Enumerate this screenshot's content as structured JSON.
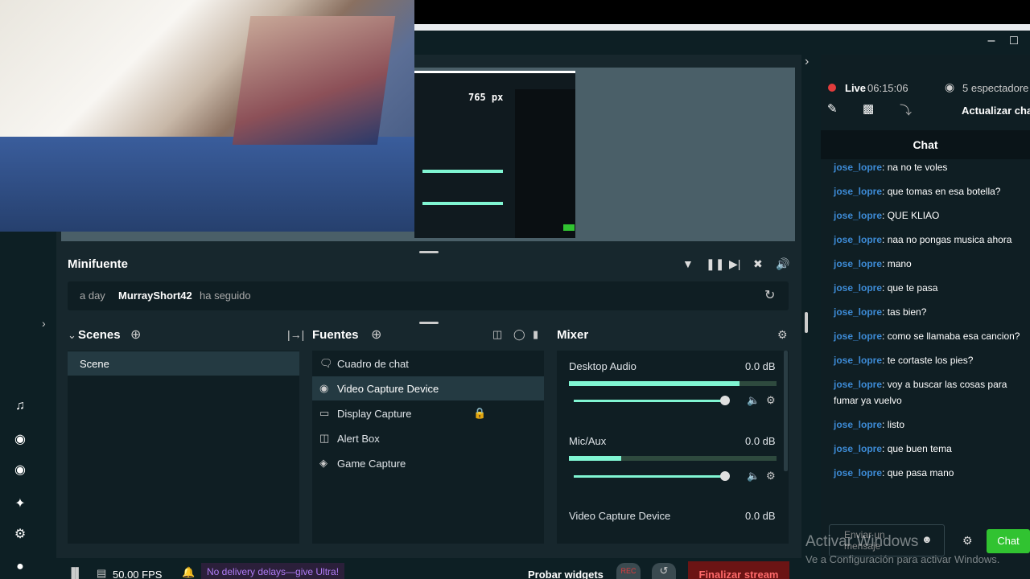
{
  "preview": {
    "px_readout": "765 px"
  },
  "minifuente": {
    "title": "Minifuente",
    "event_time": "a day",
    "event_user": "MurrayShort42",
    "event_action": "ha seguido"
  },
  "scenes": {
    "title": "Scenes",
    "items": [
      "Scene"
    ]
  },
  "sources": {
    "title": "Fuentes",
    "items": [
      "Cuadro de chat",
      "Video Capture Device",
      "Display Capture",
      "Alert Box",
      "Game Capture"
    ]
  },
  "mixer": {
    "title": "Mixer",
    "channels": [
      {
        "name": "Desktop Audio",
        "db": "0.0 dB",
        "level": 0.82,
        "volume": 1.0
      },
      {
        "name": "Mic/Aux",
        "db": "0.0 dB",
        "level": 0.25,
        "volume": 1.0
      },
      {
        "name": "Video Capture Device",
        "db": "0.0 dB"
      }
    ]
  },
  "statusbar": {
    "fps": "50.00 FPS",
    "promo": "No delivery delays—give Ultra!",
    "test_widgets": "Probar widgets",
    "rec": "REC",
    "end_stream": "Finalizar stream"
  },
  "live": {
    "label": "Live",
    "time": "06:15:06",
    "viewers": "5 espectadore",
    "update_chat": "Actualizar cha"
  },
  "chat": {
    "header": "Chat",
    "messages": [
      {
        "user": "jose_lopre",
        "text": ": na no te voles"
      },
      {
        "user": "jose_lopre",
        "text": ": que tomas en esa botella?"
      },
      {
        "user": "jose_lopre",
        "text": ": QUE KLIAO"
      },
      {
        "user": "jose_lopre",
        "text": ": naa no pongas musica ahora"
      },
      {
        "user": "jose_lopre",
        "text": ": mano"
      },
      {
        "user": "jose_lopre",
        "text": ": que te pasa"
      },
      {
        "user": "jose_lopre",
        "text": ": tas bien?"
      },
      {
        "user": "jose_lopre",
        "text": ": como se llamaba esa cancion?"
      },
      {
        "user": "jose_lopre",
        "text": ": te cortaste los pies?"
      },
      {
        "user": "jose_lopre",
        "text": ": voy a buscar las cosas para fumar ya vuelvo"
      },
      {
        "user": "jose_lopre",
        "text": ": listo"
      },
      {
        "user": "jose_lopre",
        "text": ": que buen tema"
      },
      {
        "user": "jose_lopre",
        "text": ": que pasa mano"
      }
    ],
    "input_placeholder": "Enviar un mensaje",
    "send_label": "Chat"
  },
  "watermark": {
    "line1": "Activar Windows",
    "line2": "Ve a Configuración para activar Windows."
  },
  "colors": {
    "accent": "#80f5d2",
    "live_red": "#e23c3c",
    "end_stream": "#6b1414",
    "chat_send": "#31c331"
  }
}
